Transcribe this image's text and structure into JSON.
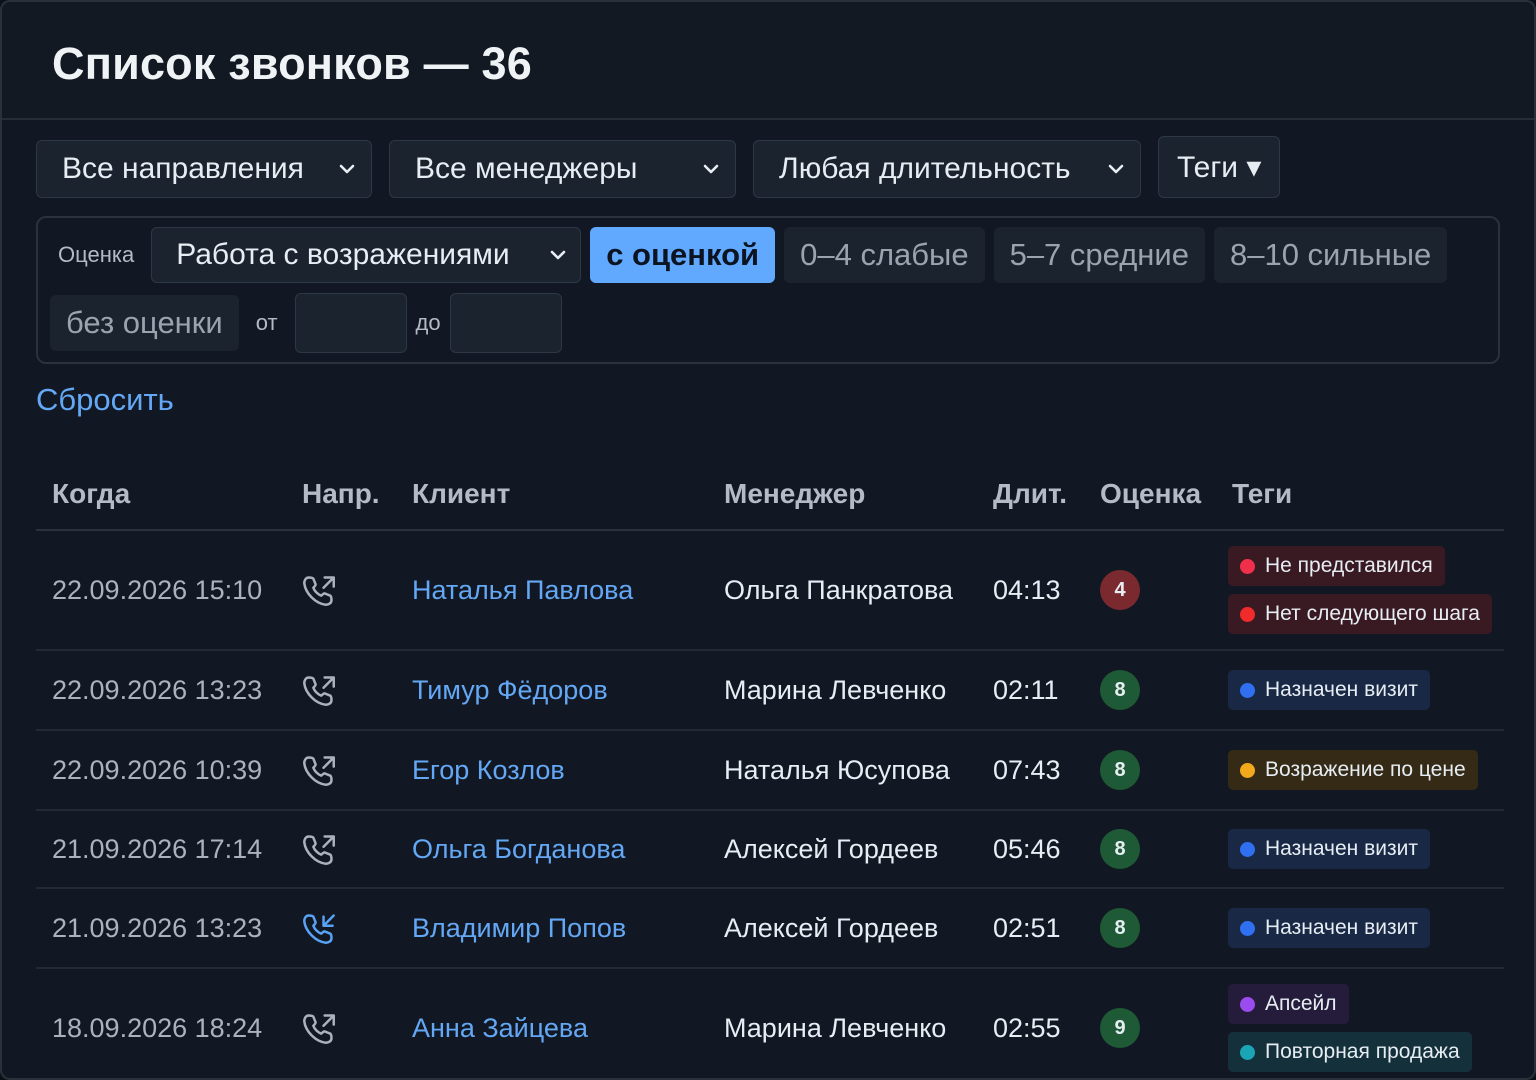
{
  "header": {
    "title": "Список звонков — 36"
  },
  "filters": {
    "direction": "Все направления",
    "manager": "Все менеджеры",
    "duration": "Любая длительность",
    "tags": "Теги ▾"
  },
  "score": {
    "label": "Оценка",
    "criterion": "Работа с возражениями",
    "chips": [
      "с оценкой",
      "0–4 слабые",
      "5–7 средние",
      "8–10 сильные",
      "без оценки"
    ],
    "active_chip": "с оценкой",
    "from_label": "от",
    "to_label": "до",
    "from_value": "",
    "to_value": ""
  },
  "reset_label": "Сбросить",
  "table": {
    "columns": [
      "Когда",
      "Напр.",
      "Клиент",
      "Менеджер",
      "Длит.",
      "Оценка",
      "Теги"
    ],
    "rows": [
      {
        "when": "22.09.2026 15:10",
        "direction": "outgoing",
        "client": "Наталья Павлова",
        "manager": "Ольга Панкратова",
        "duration": "04:13",
        "score": "4",
        "score_color": "#7a2a2e",
        "tags": [
          {
            "label": "Не представился",
            "dot": "#f0304a",
            "bg": "#3a1a22"
          },
          {
            "label": "Нет следующего шага",
            "dot": "#ef2b2b",
            "bg": "#3a1a22"
          }
        ]
      },
      {
        "when": "22.09.2026 13:23",
        "direction": "outgoing",
        "client": "Тимур Фёдоров",
        "manager": "Марина Левченко",
        "duration": "02:11",
        "score": "8",
        "score_color": "#1f5a36",
        "tags": [
          {
            "label": "Назначен визит",
            "dot": "#2f6ff0",
            "bg": "#182845"
          }
        ]
      },
      {
        "when": "22.09.2026 10:39",
        "direction": "outgoing",
        "client": "Егор Козлов",
        "manager": "Наталья Юсупова",
        "duration": "07:43",
        "score": "8",
        "score_color": "#1f5a36",
        "tags": [
          {
            "label": "Возражение по цене",
            "dot": "#f2a91c",
            "bg": "#352a16"
          }
        ]
      },
      {
        "when": "21.09.2026 17:14",
        "direction": "outgoing",
        "client": "Ольга Богданова",
        "manager": "Алексей Гордеев",
        "duration": "05:46",
        "score": "8",
        "score_color": "#1f5a36",
        "tags": [
          {
            "label": "Назначен визит",
            "dot": "#2f6ff0",
            "bg": "#182845"
          }
        ]
      },
      {
        "when": "21.09.2026 13:23",
        "direction": "incoming",
        "client": "Владимир Попов",
        "manager": "Алексей Гордеев",
        "duration": "02:51",
        "score": "8",
        "score_color": "#1f5a36",
        "tags": [
          {
            "label": "Назначен визит",
            "dot": "#2f6ff0",
            "bg": "#182845"
          }
        ]
      },
      {
        "when": "18.09.2026 18:24",
        "direction": "outgoing",
        "client": "Анна Зайцева",
        "manager": "Марина Левченко",
        "duration": "02:55",
        "score": "9",
        "score_color": "#1f5a36",
        "tags": [
          {
            "label": "Апсейл",
            "dot": "#9a4cf0",
            "bg": "#241c3a"
          },
          {
            "label": "Повторная продажа",
            "dot": "#1ba6b8",
            "bg": "#14303a"
          }
        ]
      }
    ]
  }
}
